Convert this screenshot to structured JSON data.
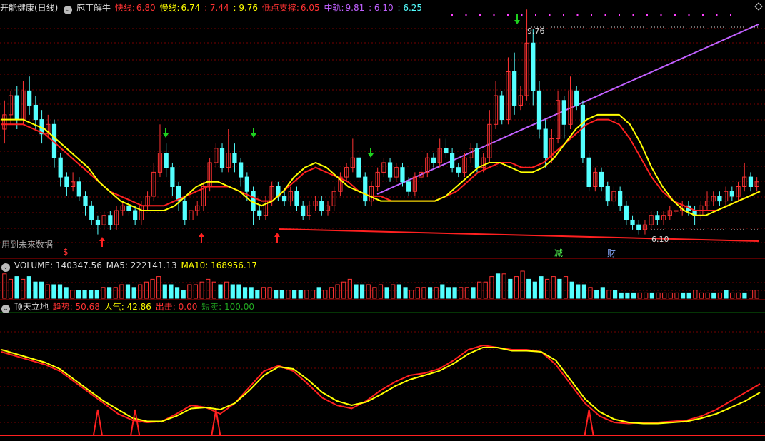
{
  "header": {
    "stock_title": "开能健康(日线)",
    "indicator_name": "庖丁解牛",
    "fast_label": "快线:",
    "fast_value": "6.80",
    "slow_label": "慢线:",
    "slow_value": "6.74",
    "value_a": ": 7.44",
    "value_b": ": 9.76",
    "support_label": "低点支撑:",
    "support_value": "6.05",
    "mid_label": "中轨:",
    "mid_value": "9.81",
    "value_c": ": 6.10",
    "value_d": ": 6.25"
  },
  "main_notes": {
    "future_data": "用到未来数据",
    "high_label": "9.76",
    "low_label": "6.10",
    "marker_s": "$",
    "marker_jian": "减",
    "marker_cai": "财"
  },
  "volume_header": {
    "label": "VOLUME: 140347.56",
    "ma5": "MA5: 222141.13",
    "ma10": "MA10: 168956.17"
  },
  "osc_header": {
    "name": "顶天立地",
    "trend": "趋势: 50.68",
    "pop": "人气: 42.86",
    "strike": "出击: 0.00",
    "short": "短卖: 100.00"
  },
  "colors": {
    "up": "#ff3232",
    "down": "#54ffff",
    "fast": "#ffff00",
    "slow": "#ff2020",
    "trend_line": "#c060ff",
    "support_line": "#ff2020",
    "grid": "#7a0000"
  },
  "chart_data": {
    "type": "candlestick",
    "price_range": [
      5.4,
      10.2
    ],
    "candles": [
      [
        7.8,
        8.1,
        8.4,
        7.5
      ],
      [
        8.1,
        8.5,
        8.6,
        7.9
      ],
      [
        8.5,
        8.0,
        8.7,
        7.8
      ],
      [
        8.0,
        8.6,
        8.8,
        7.9
      ],
      [
        8.6,
        8.3,
        8.9,
        8.1
      ],
      [
        8.3,
        8.0,
        8.5,
        7.8
      ],
      [
        8.0,
        7.7,
        8.2,
        7.5
      ],
      [
        7.7,
        7.9,
        8.1,
        7.6
      ],
      [
        7.9,
        7.2,
        8.0,
        7.0
      ],
      [
        7.2,
        6.8,
        7.3,
        6.6
      ],
      [
        6.8,
        6.6,
        6.9,
        6.4
      ],
      [
        6.6,
        6.7,
        6.9,
        6.5
      ],
      [
        6.7,
        6.4,
        6.8,
        6.3
      ],
      [
        6.4,
        6.2,
        6.5,
        6.0
      ],
      [
        6.2,
        5.9,
        6.3,
        5.8
      ],
      [
        5.9,
        5.8,
        6.0,
        5.6
      ],
      [
        5.8,
        6.0,
        6.1,
        5.7
      ],
      [
        6.0,
        5.8,
        6.1,
        5.7
      ],
      [
        5.8,
        6.1,
        6.2,
        5.7
      ],
      [
        6.1,
        6.2,
        6.3,
        6.0
      ],
      [
        6.2,
        6.1,
        6.3,
        6.0
      ],
      [
        6.1,
        5.9,
        6.2,
        5.8
      ],
      [
        5.9,
        6.2,
        6.3,
        5.8
      ],
      [
        6.2,
        6.4,
        6.5,
        6.1
      ],
      [
        6.4,
        6.9,
        7.1,
        6.3
      ],
      [
        6.9,
        7.3,
        7.9,
        6.8
      ],
      [
        7.3,
        7.0,
        7.5,
        6.8
      ],
      [
        7.0,
        6.6,
        7.1,
        6.4
      ],
      [
        6.6,
        6.3,
        6.7,
        6.1
      ],
      [
        6.3,
        5.9,
        6.4,
        5.8
      ],
      [
        5.9,
        6.1,
        6.2,
        5.8
      ],
      [
        6.1,
        6.2,
        6.3,
        6.0
      ],
      [
        6.2,
        6.6,
        6.7,
        6.1
      ],
      [
        6.6,
        7.1,
        7.2,
        6.5
      ],
      [
        7.1,
        7.4,
        7.5,
        7.0
      ],
      [
        7.4,
        7.0,
        7.5,
        6.9
      ],
      [
        7.0,
        7.3,
        7.8,
        6.9
      ],
      [
        7.3,
        7.1,
        7.5,
        6.9
      ],
      [
        7.1,
        6.8,
        7.2,
        6.6
      ],
      [
        6.8,
        6.5,
        6.9,
        6.3
      ],
      [
        6.5,
        6.1,
        6.6,
        5.8
      ],
      [
        6.1,
        6.0,
        6.2,
        5.9
      ],
      [
        6.0,
        6.3,
        6.4,
        5.9
      ],
      [
        6.3,
        6.6,
        6.7,
        6.2
      ],
      [
        6.6,
        6.4,
        6.7,
        6.3
      ],
      [
        6.4,
        6.3,
        6.5,
        6.2
      ],
      [
        6.3,
        6.5,
        6.6,
        6.2
      ],
      [
        6.5,
        6.2,
        6.6,
        6.1
      ],
      [
        6.2,
        6.0,
        6.3,
        5.9
      ],
      [
        6.0,
        6.2,
        6.3,
        5.9
      ],
      [
        6.2,
        6.3,
        6.4,
        6.1
      ],
      [
        6.3,
        6.1,
        6.4,
        6.0
      ],
      [
        6.1,
        6.2,
        6.3,
        6.0
      ],
      [
        6.2,
        6.5,
        6.6,
        6.1
      ],
      [
        6.5,
        6.8,
        6.9,
        6.4
      ],
      [
        6.8,
        7.0,
        7.1,
        6.7
      ],
      [
        7.0,
        7.2,
        7.6,
        6.9
      ],
      [
        7.2,
        6.8,
        7.3,
        6.7
      ],
      [
        6.8,
        6.3,
        6.9,
        6.2
      ],
      [
        6.3,
        6.6,
        6.7,
        6.2
      ],
      [
        6.6,
        6.9,
        7.0,
        6.5
      ],
      [
        6.9,
        7.1,
        7.2,
        6.8
      ],
      [
        7.1,
        6.8,
        7.2,
        6.7
      ],
      [
        6.8,
        7.0,
        7.1,
        6.7
      ],
      [
        7.0,
        6.7,
        7.1,
        6.6
      ],
      [
        6.7,
        6.5,
        6.8,
        6.4
      ],
      [
        6.5,
        6.8,
        6.9,
        6.4
      ],
      [
        6.8,
        6.9,
        7.0,
        6.7
      ],
      [
        6.9,
        7.2,
        7.3,
        6.8
      ],
      [
        7.2,
        7.1,
        7.3,
        7.0
      ],
      [
        7.1,
        7.4,
        7.6,
        7.0
      ],
      [
        7.4,
        7.3,
        7.6,
        7.2
      ],
      [
        7.3,
        7.0,
        7.4,
        6.9
      ],
      [
        7.0,
        6.9,
        7.1,
        6.8
      ],
      [
        6.9,
        7.2,
        7.3,
        6.8
      ],
      [
        7.2,
        7.4,
        7.5,
        7.1
      ],
      [
        7.4,
        7.0,
        7.5,
        6.9
      ],
      [
        7.0,
        7.2,
        7.3,
        6.9
      ],
      [
        7.2,
        7.9,
        8.2,
        7.1
      ],
      [
        7.9,
        8.5,
        8.8,
        7.8
      ],
      [
        8.5,
        8.0,
        8.6,
        7.9
      ],
      [
        8.0,
        9.0,
        9.3,
        7.9
      ],
      [
        9.0,
        8.3,
        9.4,
        8.1
      ],
      [
        8.3,
        8.5,
        8.7,
        8.2
      ],
      [
        8.5,
        9.6,
        10.3,
        8.4
      ],
      [
        9.6,
        8.6,
        9.9,
        8.3
      ],
      [
        8.6,
        7.8,
        8.8,
        7.6
      ],
      [
        7.8,
        7.2,
        8.0,
        7.0
      ],
      [
        7.2,
        7.6,
        7.8,
        7.1
      ],
      [
        7.6,
        8.4,
        8.6,
        7.5
      ],
      [
        8.4,
        7.9,
        8.5,
        7.6
      ],
      [
        7.9,
        8.6,
        8.9,
        7.8
      ],
      [
        8.6,
        8.3,
        8.7,
        8.2
      ],
      [
        8.3,
        7.2,
        8.4,
        7.1
      ],
      [
        7.2,
        6.6,
        7.3,
        6.5
      ],
      [
        6.6,
        6.9,
        7.0,
        6.5
      ],
      [
        6.9,
        6.6,
        7.0,
        6.5
      ],
      [
        6.6,
        6.3,
        6.7,
        6.2
      ],
      [
        6.3,
        6.5,
        6.6,
        6.2
      ],
      [
        6.5,
        6.2,
        6.6,
        6.1
      ],
      [
        6.2,
        5.9,
        6.3,
        5.8
      ],
      [
        5.9,
        5.8,
        6.0,
        5.7
      ],
      [
        5.8,
        5.7,
        5.9,
        5.6
      ],
      [
        5.7,
        5.8,
        5.9,
        5.6
      ],
      [
        5.8,
        6.0,
        6.1,
        5.7
      ],
      [
        6.0,
        5.9,
        6.1,
        5.8
      ],
      [
        5.9,
        6.0,
        6.1,
        5.8
      ],
      [
        6.0,
        6.1,
        6.2,
        5.9
      ],
      [
        6.1,
        6.1,
        6.2,
        6.0
      ],
      [
        6.1,
        6.2,
        6.3,
        6.0
      ],
      [
        6.2,
        6.1,
        6.3,
        6.0
      ],
      [
        6.1,
        6.0,
        6.2,
        5.8
      ],
      [
        6.0,
        6.2,
        6.3,
        5.9
      ],
      [
        6.2,
        6.3,
        6.5,
        6.1
      ],
      [
        6.3,
        6.4,
        6.5,
        6.2
      ],
      [
        6.4,
        6.3,
        6.5,
        6.2
      ],
      [
        6.3,
        6.5,
        6.6,
        6.2
      ],
      [
        6.5,
        6.4,
        6.6,
        6.3
      ],
      [
        6.4,
        6.6,
        6.7,
        6.3
      ],
      [
        6.6,
        6.8,
        7.1,
        6.5
      ],
      [
        6.8,
        6.6,
        6.9,
        6.5
      ],
      [
        6.6,
        6.7,
        6.8,
        6.5
      ]
    ],
    "fast_line": [
      8.0,
      8.0,
      8.0,
      7.9,
      7.8,
      7.6,
      7.4,
      7.2,
      7.0,
      6.7,
      6.5,
      6.3,
      6.2,
      6.1,
      6.1,
      6.1,
      6.2,
      6.4,
      6.6,
      6.7,
      6.7,
      6.6,
      6.5,
      6.3,
      6.2,
      6.3,
      6.5,
      6.8,
      7.0,
      7.1,
      7.0,
      6.8,
      6.6,
      6.5,
      6.4,
      6.3,
      6.3,
      6.3,
      6.3,
      6.3,
      6.3,
      6.4,
      6.6,
      6.8,
      7.0,
      7.1,
      7.1,
      7.0,
      6.9,
      6.9,
      7.0,
      7.2,
      7.5,
      7.8,
      8.0,
      8.1,
      8.1,
      8.1,
      7.9,
      7.5,
      7.0,
      6.6,
      6.3,
      6.1,
      6.0,
      6.0,
      6.1,
      6.2,
      6.3,
      6.4,
      6.5
    ],
    "slow_line": [
      7.9,
      7.9,
      7.9,
      7.8,
      7.7,
      7.5,
      7.3,
      7.1,
      6.9,
      6.7,
      6.5,
      6.4,
      6.3,
      6.2,
      6.2,
      6.2,
      6.3,
      6.4,
      6.5,
      6.6,
      6.6,
      6.6,
      6.5,
      6.4,
      6.3,
      6.3,
      6.5,
      6.7,
      6.9,
      7.0,
      6.9,
      6.8,
      6.7,
      6.5,
      6.4,
      6.4,
      6.3,
      6.3,
      6.3,
      6.3,
      6.3,
      6.4,
      6.5,
      6.7,
      6.9,
      7.0,
      7.1,
      7.1,
      7.0,
      7.0,
      7.1,
      7.3,
      7.5,
      7.7,
      7.9,
      8.0,
      8.0,
      7.9,
      7.6,
      7.2,
      6.8,
      6.5,
      6.3,
      6.2,
      6.1,
      6.1,
      6.1,
      6.2,
      6.3,
      6.4,
      6.5
    ],
    "volume": [
      0.9,
      0.7,
      0.8,
      0.7,
      0.8,
      0.6,
      0.6,
      0.5,
      0.5,
      0.5,
      0.4,
      0.3,
      0.3,
      0.3,
      0.3,
      0.3,
      0.4,
      0.4,
      0.4,
      0.5,
      0.5,
      0.4,
      0.5,
      0.6,
      0.7,
      0.8,
      0.5,
      0.5,
      0.4,
      0.3,
      0.5,
      0.5,
      0.6,
      0.7,
      0.6,
      0.5,
      0.6,
      0.5,
      0.5,
      0.4,
      0.4,
      0.3,
      0.4,
      0.4,
      0.3,
      0.3,
      0.3,
      0.3,
      0.3,
      0.3,
      0.3,
      0.4,
      0.3,
      0.4,
      0.5,
      0.6,
      0.7,
      0.5,
      0.5,
      0.5,
      0.4,
      0.5,
      0.4,
      0.5,
      0.5,
      0.4,
      0.3,
      0.4,
      0.4,
      0.4,
      0.4,
      0.5,
      0.4,
      0.4,
      0.4,
      0.4,
      0.4,
      0.6,
      0.6,
      0.8,
      0.9,
      0.9,
      0.7,
      0.8,
      1.0,
      0.7,
      0.6,
      0.8,
      0.7,
      0.8,
      0.7,
      0.8,
      0.6,
      0.5,
      0.5,
      0.4,
      0.3,
      0.4,
      0.3,
      0.3,
      0.2,
      0.2,
      0.2,
      0.2,
      0.2,
      0.2,
      0.2,
      0.2,
      0.2,
      0.2,
      0.2,
      0.2,
      0.3,
      0.2,
      0.2,
      0.2,
      0.2,
      0.3,
      0.2,
      0.2,
      0.2,
      0.3,
      0.3
    ],
    "osc_red": [
      78,
      74,
      70,
      66,
      60,
      50,
      40,
      30,
      20,
      14,
      12,
      13,
      20,
      28,
      26,
      20,
      30,
      45,
      60,
      65,
      60,
      48,
      35,
      28,
      25,
      32,
      42,
      50,
      56,
      58,
      62,
      70,
      80,
      84,
      82,
      80,
      80,
      78,
      66,
      48,
      30,
      18,
      12,
      11,
      12,
      12,
      13,
      14,
      18,
      24,
      32,
      40,
      48
    ],
    "osc_yellow": [
      80,
      76,
      72,
      68,
      62,
      52,
      42,
      32,
      24,
      16,
      13,
      13,
      18,
      25,
      26,
      24,
      30,
      42,
      56,
      64,
      62,
      52,
      40,
      32,
      28,
      31,
      38,
      46,
      52,
      56,
      60,
      67,
      76,
      82,
      82,
      79,
      79,
      78,
      70,
      52,
      34,
      22,
      15,
      12,
      11,
      11,
      12,
      13,
      16,
      20,
      26,
      32,
      40
    ],
    "signals": [
      15,
      21,
      34,
      94
    ]
  }
}
